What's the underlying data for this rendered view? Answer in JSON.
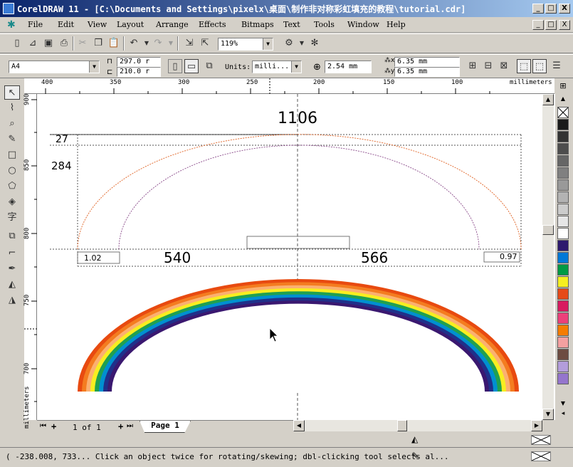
{
  "window": {
    "title": "CorelDRAW 11 - [C:\\Documents and Settings\\pixelx\\桌面\\制作非对称彩虹填充的教程\\tutorial.cdr]",
    "minimize_label": "_",
    "maximize_label": "□",
    "close_label": "X"
  },
  "menu": [
    "File",
    "Edit",
    "View",
    "Layout",
    "Arrange",
    "Effects",
    "Bitmaps",
    "Text",
    "Tools",
    "Window",
    "Help"
  ],
  "standard_toolbar": {
    "zoom": "119%"
  },
  "property_bar": {
    "paper_type": "A4",
    "width": "297.0 r",
    "height": "210.0 r",
    "units_label": "Units:",
    "units_value": "milli...",
    "nudge": "2.54 mm",
    "dup_x": "6.35 mm",
    "dup_y": "6.35 mm"
  },
  "hruler_ticks": [
    "400",
    "350",
    "300",
    "250",
    "200",
    "150",
    "100",
    "millimeters"
  ],
  "vruler_ticks": [
    "900",
    "850",
    "800",
    "750",
    "700",
    "millimeters"
  ],
  "drawing": {
    "dim_total": "1106",
    "dim_small": "27",
    "dim_height": "284",
    "dim_left": "540",
    "dim_right": "566",
    "box_left": "1.02",
    "box_right": "0.97"
  },
  "rainbow_colors": [
    "#e84a10",
    "#f47c20",
    "#fbb070",
    "#f8ee20",
    "#20a050",
    "#0090d0",
    "#20308a",
    "#3a1870"
  ],
  "palette": [
    "#ffffff",
    "#1a1a1a",
    "#333333",
    "#4d4d4d",
    "#666666",
    "#808080",
    "#999999",
    "#b3b3b3",
    "#cccccc",
    "#e6e6e6",
    "#ffffff",
    "#2e1a6e",
    "#0078d7",
    "#009a44",
    "#f5ef20",
    "#e64a19",
    "#d81b60",
    "#ec407a",
    "#f57c00",
    "#f4a0a0",
    "#6d4c41",
    "#b39ddb",
    "#9575cd"
  ],
  "page_nav": {
    "page_count": "1 of 1",
    "tab_label": "Page 1"
  },
  "status": {
    "text": "( -238.008, 733... Click an object twice for rotating/skewing; dbl-clicking tool selects al..."
  }
}
